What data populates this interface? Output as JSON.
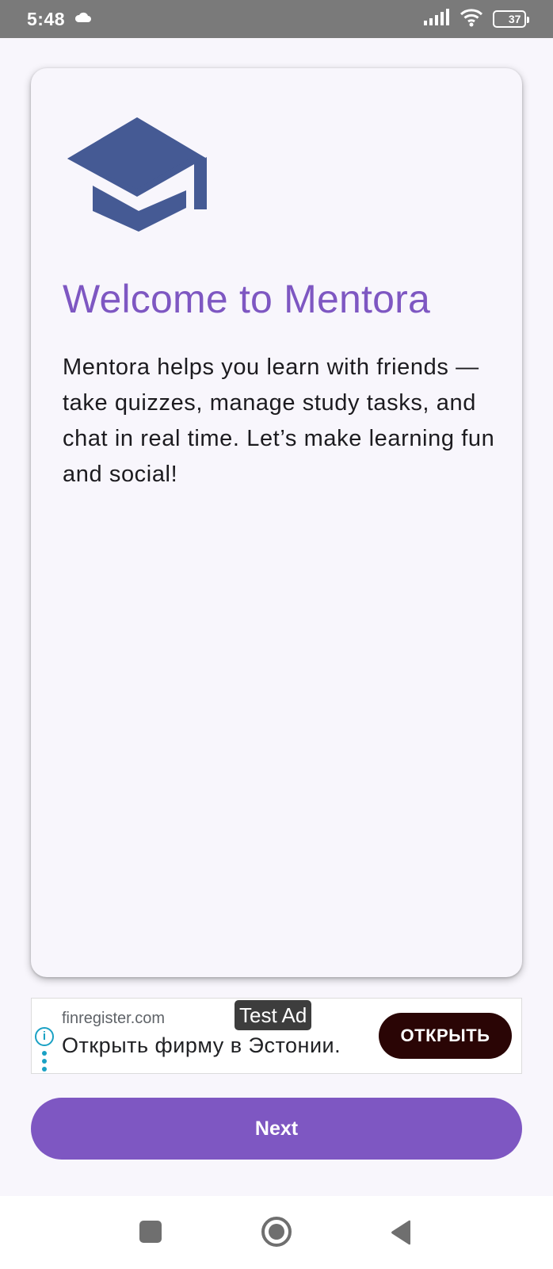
{
  "status_bar": {
    "time": "5:48",
    "battery": "37",
    "battery_level_percent": 37,
    "icons": [
      "cloud-icon",
      "signal-icon",
      "wifi-icon",
      "battery-icon"
    ]
  },
  "welcome_card": {
    "logo_icon": "graduation-cap-icon",
    "logo_color": "#455a94",
    "title": "Welcome to Mentora",
    "body": "Mentora helps you learn with friends — take quizzes, manage study tasks, and chat in real time. Let’s make learning fun and social!"
  },
  "ad": {
    "badge": "Test Ad",
    "domain": "finregister.com",
    "headline": "Открыть фирму в Эстонии.",
    "cta": "ОТКРЫТЬ"
  },
  "next_button": {
    "label": "Next"
  },
  "nav_bar": {
    "icons": [
      "recents-icon",
      "home-icon",
      "back-icon"
    ]
  },
  "colors": {
    "accent": "#7e57c2",
    "background": "#f8f6fc",
    "status_bar": "#7a7a7a",
    "ad_cta": "#2a0505"
  }
}
